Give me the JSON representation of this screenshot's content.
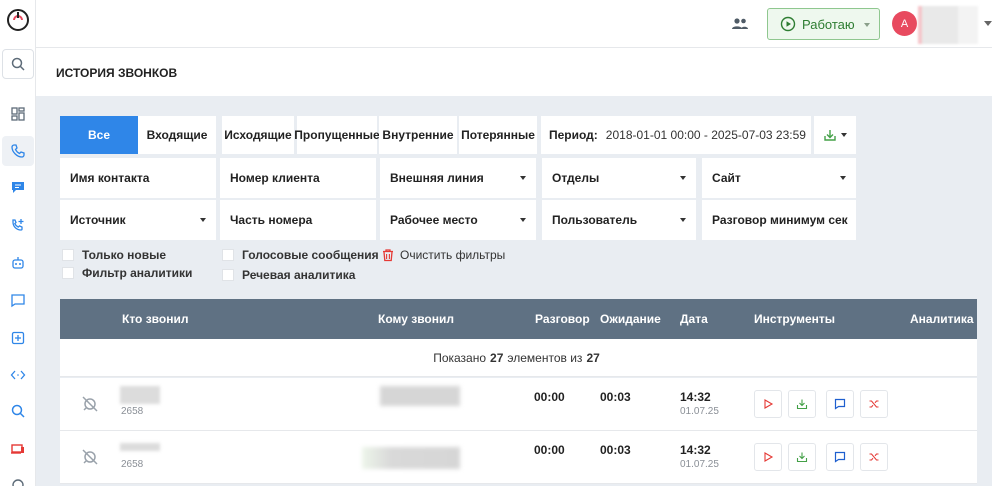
{
  "header": {
    "status_label": "Работаю",
    "avatar_initial": "A"
  },
  "page": {
    "title": "ИСТОРИЯ ЗВОНКОВ"
  },
  "tabs": [
    {
      "label": "Все",
      "active": true
    },
    {
      "label": "Входящие",
      "active": false
    },
    {
      "label": "Исходящие",
      "active": false
    },
    {
      "label": "Пропущенные",
      "active": false
    },
    {
      "label": "Внутренние",
      "active": false
    },
    {
      "label": "Потерянные",
      "active": false
    }
  ],
  "period": {
    "label": "Период:",
    "value": "2018-01-01 00:00 - 2025-07-03 23:59"
  },
  "filters": {
    "contact_name": "Имя контакта",
    "client_number": "Номер клиента",
    "external_line": "Внешняя линия",
    "departments": "Отделы",
    "site": "Сайт",
    "source": "Источник",
    "number_part": "Часть номера",
    "workplace": "Рабочее место",
    "user": "Пользователь",
    "min_talk": "Разговор минимум сек"
  },
  "checkboxes": {
    "only_new": "Только новые",
    "voice_messages": "Голосовые сообщения",
    "analytics_filter": "Фильтр аналитики",
    "speech_analytics": "Речевая аналитика"
  },
  "clear_filters": "Очистить фильтры",
  "table": {
    "headers": {
      "caller": "Кто звонил",
      "callee": "Кому звонил",
      "talk": "Разговор",
      "wait": "Ожидание",
      "date": "Дата",
      "tools": "Инструменты",
      "analytics": "Аналитика"
    },
    "summary": {
      "prefix": "Показано",
      "shown": "27",
      "middle": "элементов из",
      "total": "27"
    },
    "rows": [
      {
        "ext": "2658",
        "talk": "00:00",
        "wait": "00:03",
        "time": "14:32",
        "date": "01.07.25"
      },
      {
        "ext": "2658",
        "talk": "00:00",
        "wait": "00:03",
        "time": "14:32",
        "date": "01.07.25"
      }
    ]
  },
  "colors": {
    "accent": "#2f86e8",
    "table_header": "#5f7183",
    "status_green": "#2e7d32",
    "danger": "#e53935",
    "avatar": "#e84a5f"
  },
  "icons": {
    "sidebar": [
      "search-icon",
      "dashboard-icon",
      "phone-icon",
      "chat-icon",
      "add-call-icon",
      "bot-icon",
      "message-icon",
      "add-box-icon",
      "code-icon",
      "search-icon",
      "devices-icon"
    ],
    "row_tools": [
      "play-icon",
      "download-icon",
      "comment-icon",
      "shuffle-icon"
    ]
  }
}
